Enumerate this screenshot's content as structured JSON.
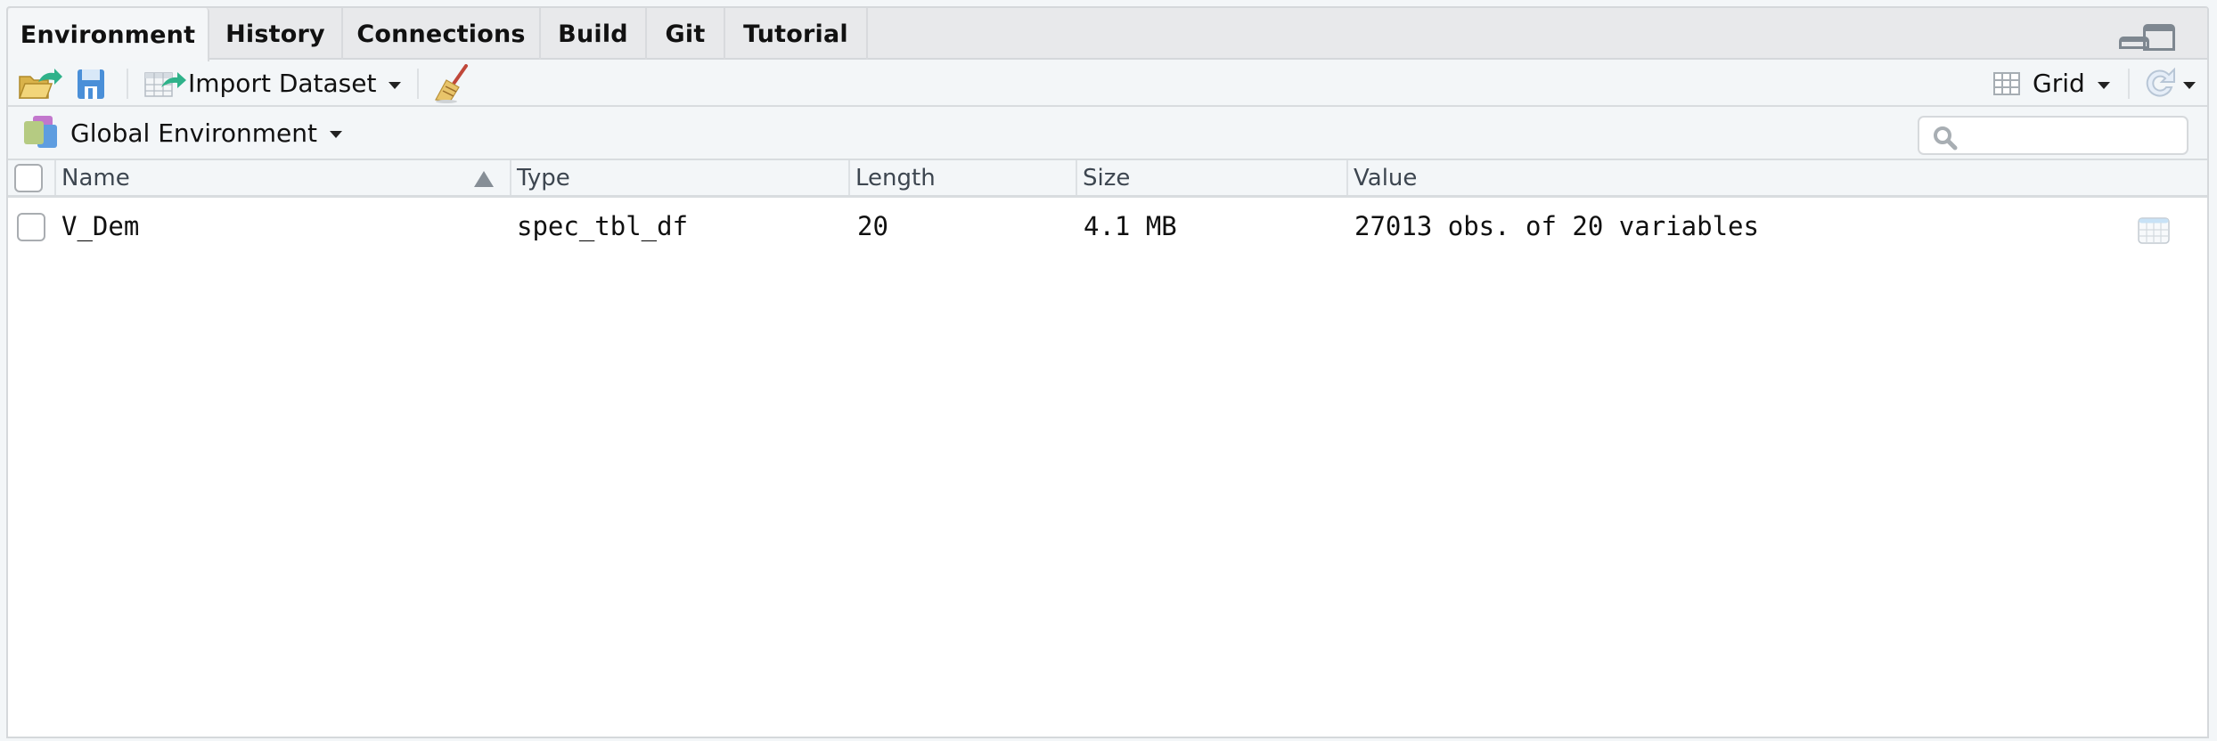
{
  "tabs": [
    {
      "label": "Environment",
      "active": true
    },
    {
      "label": "History",
      "active": false
    },
    {
      "label": "Connections",
      "active": false
    },
    {
      "label": "Build",
      "active": false
    },
    {
      "label": "Git",
      "active": false
    },
    {
      "label": "Tutorial",
      "active": false
    }
  ],
  "toolbar": {
    "open_icon": "open-folder-icon",
    "save_icon": "save-icon",
    "import_label": "Import Dataset",
    "clear_icon": "broom-icon",
    "view_mode_label": "Grid",
    "refresh_icon": "refresh-icon"
  },
  "environment": {
    "selected": "Global Environment",
    "search_placeholder": "",
    "search_value": ""
  },
  "table": {
    "columns": [
      "Name",
      "Type",
      "Length",
      "Size",
      "Value"
    ],
    "sort": {
      "column": "Name",
      "direction": "ascending"
    },
    "rows": [
      {
        "name": "V_Dem",
        "type": "spec_tbl_df",
        "length": "20",
        "size": "4.1 MB",
        "value": "27013 obs. of 20 variables",
        "checked": false
      }
    ]
  },
  "colors": {
    "tab_active_bg": "#f4f6f8",
    "tab_inactive_bg": "#e8e9eb",
    "toolbar_bg": "#f3f6f8",
    "border": "#d5d8db",
    "header_text": "#3d4650"
  }
}
